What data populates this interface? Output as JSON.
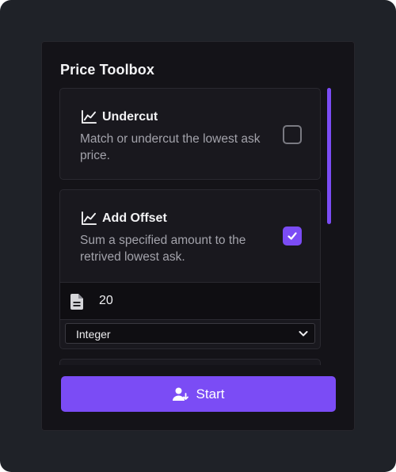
{
  "panel": {
    "title": "Price Toolbox"
  },
  "cards": [
    {
      "title": "Undercut",
      "description": "Match or undercut the lowest ask price.",
      "icon": "chart-line-icon",
      "checked": false
    },
    {
      "title": "Add Offset",
      "description": "Sum a specified amount to the retrived lowest ask.",
      "icon": "chart-line-icon",
      "checked": true,
      "value_icon": "document-icon",
      "value": "20",
      "type_select": {
        "selected": "Integer"
      }
    }
  ],
  "start_button": {
    "label": "Start",
    "icon": "user-start-icon"
  },
  "colors": {
    "accent": "#7b4cf5",
    "panel_bg": "#141318",
    "card_bg": "#19181e",
    "window_bg": "#1f2228"
  }
}
